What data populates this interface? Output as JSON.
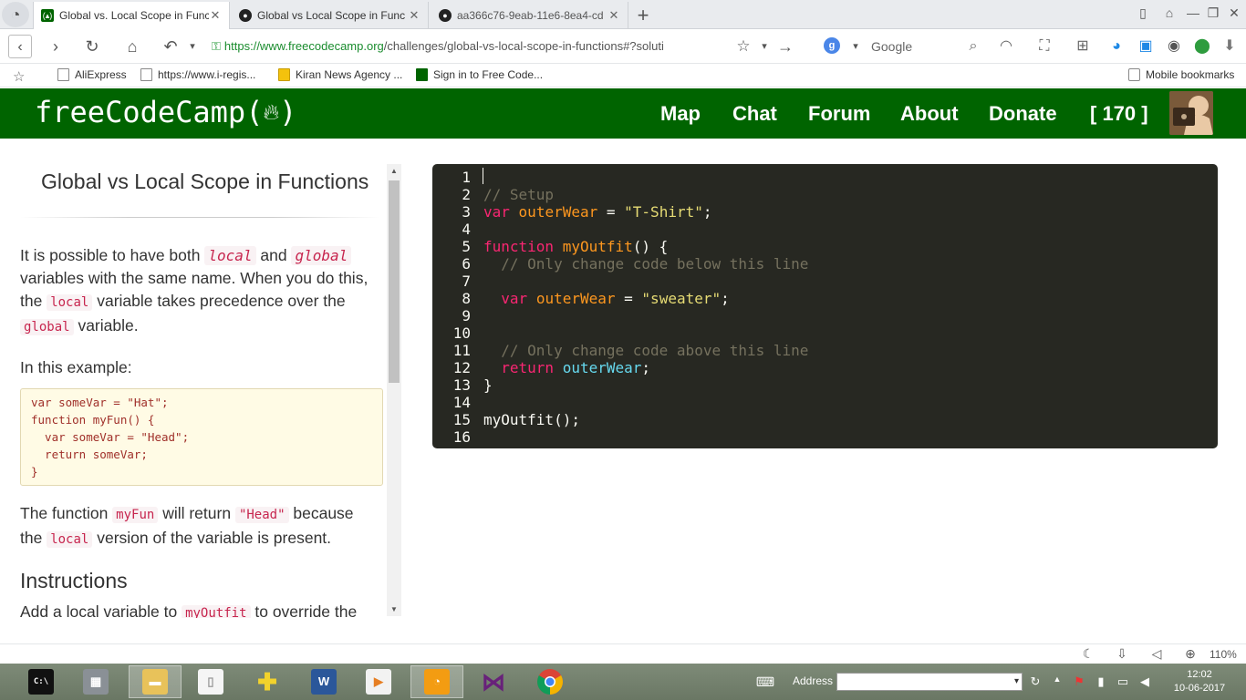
{
  "browser": {
    "tabs": [
      {
        "title": "Global vs. Local Scope in Func",
        "active": true,
        "favicon": "freecodecamp-icon"
      },
      {
        "title": "Global vs Local Scope in Func",
        "active": false,
        "favicon": "github-icon"
      },
      {
        "title": "aa366c76-9eab-11e6-8ea4-cd",
        "active": false,
        "favicon": "github-icon"
      }
    ],
    "close_glyph": "✕",
    "new_tab_glyph": "+",
    "url_host": "https://www.freecodecamp.org",
    "url_path": "/challenges/global-vs-local-scope-in-functions#?soluti",
    "search_placeholder": "Google",
    "bookmarks": [
      {
        "label": "AliExpress"
      },
      {
        "label": "https://www.i-regis..."
      },
      {
        "label": "Kiran News Agency ..."
      },
      {
        "label": "Sign in to Free Code..."
      }
    ],
    "mobile_bookmarks": "Mobile bookmarks",
    "zoom": "110%"
  },
  "fcc": {
    "logo": "freeCodeCamp(",
    "logo_end": ")",
    "nav": {
      "map": "Map",
      "chat": "Chat",
      "forum": "Forum",
      "about": "About",
      "donate": "Donate",
      "points": "[ 170 ]"
    }
  },
  "challenge": {
    "title": "Global vs Local Scope in Functions",
    "p1": {
      "a": "It is possible to have both ",
      "local": "local",
      "b": " and ",
      "global": "global",
      "c": " variables with the same name. When you do this, the ",
      "local2": "local",
      "d": " variable takes precedence over the ",
      "global2": "global",
      "e": " variable."
    },
    "p2": "In this example:",
    "example_lines": [
      "var someVar = \"Hat\";",
      "function myFun() {",
      "  var someVar = \"Head\";",
      "  return someVar;",
      "}"
    ],
    "p3": {
      "a": "The function ",
      "fn": "myFun",
      "b": " will return ",
      "ret": "\"Head\"",
      "c": " because the ",
      "local": "local",
      "d": " version of the variable is present."
    },
    "instructions_heading": "Instructions",
    "p4": {
      "a": "Add a local variable to ",
      "fn": "myOutfit",
      "b": " to override the"
    }
  },
  "editor": {
    "line_numbers": [
      "1",
      "2",
      "3",
      "4",
      "5",
      "6",
      "7",
      "8",
      "9",
      "10",
      "11",
      "12",
      "13",
      "14",
      "15",
      "16"
    ]
  },
  "taskbar": {
    "address_label": "Address",
    "time": "12:02",
    "date": "10-06-2017"
  },
  "colors": {
    "fcc_green": "#006400",
    "editor_bg": "#272822"
  }
}
